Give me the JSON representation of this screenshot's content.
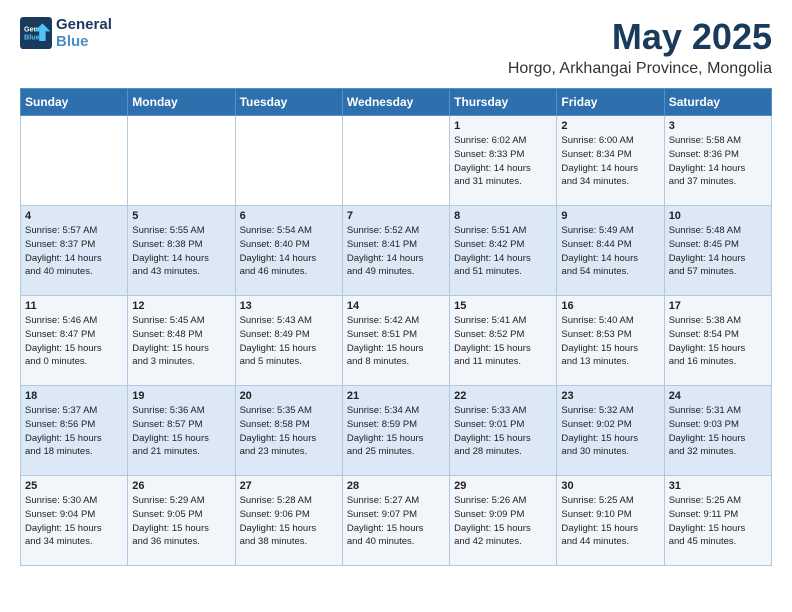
{
  "header": {
    "logo_line1": "General",
    "logo_line2": "Blue",
    "month_title": "May 2025",
    "location": "Horgo, Arkhangai Province, Mongolia"
  },
  "days_of_week": [
    "Sunday",
    "Monday",
    "Tuesday",
    "Wednesday",
    "Thursday",
    "Friday",
    "Saturday"
  ],
  "weeks": [
    [
      {
        "day": "",
        "info": ""
      },
      {
        "day": "",
        "info": ""
      },
      {
        "day": "",
        "info": ""
      },
      {
        "day": "",
        "info": ""
      },
      {
        "day": "1",
        "info": "Sunrise: 6:02 AM\nSunset: 8:33 PM\nDaylight: 14 hours\nand 31 minutes."
      },
      {
        "day": "2",
        "info": "Sunrise: 6:00 AM\nSunset: 8:34 PM\nDaylight: 14 hours\nand 34 minutes."
      },
      {
        "day": "3",
        "info": "Sunrise: 5:58 AM\nSunset: 8:36 PM\nDaylight: 14 hours\nand 37 minutes."
      }
    ],
    [
      {
        "day": "4",
        "info": "Sunrise: 5:57 AM\nSunset: 8:37 PM\nDaylight: 14 hours\nand 40 minutes."
      },
      {
        "day": "5",
        "info": "Sunrise: 5:55 AM\nSunset: 8:38 PM\nDaylight: 14 hours\nand 43 minutes."
      },
      {
        "day": "6",
        "info": "Sunrise: 5:54 AM\nSunset: 8:40 PM\nDaylight: 14 hours\nand 46 minutes."
      },
      {
        "day": "7",
        "info": "Sunrise: 5:52 AM\nSunset: 8:41 PM\nDaylight: 14 hours\nand 49 minutes."
      },
      {
        "day": "8",
        "info": "Sunrise: 5:51 AM\nSunset: 8:42 PM\nDaylight: 14 hours\nand 51 minutes."
      },
      {
        "day": "9",
        "info": "Sunrise: 5:49 AM\nSunset: 8:44 PM\nDaylight: 14 hours\nand 54 minutes."
      },
      {
        "day": "10",
        "info": "Sunrise: 5:48 AM\nSunset: 8:45 PM\nDaylight: 14 hours\nand 57 minutes."
      }
    ],
    [
      {
        "day": "11",
        "info": "Sunrise: 5:46 AM\nSunset: 8:47 PM\nDaylight: 15 hours\nand 0 minutes."
      },
      {
        "day": "12",
        "info": "Sunrise: 5:45 AM\nSunset: 8:48 PM\nDaylight: 15 hours\nand 3 minutes."
      },
      {
        "day": "13",
        "info": "Sunrise: 5:43 AM\nSunset: 8:49 PM\nDaylight: 15 hours\nand 5 minutes."
      },
      {
        "day": "14",
        "info": "Sunrise: 5:42 AM\nSunset: 8:51 PM\nDaylight: 15 hours\nand 8 minutes."
      },
      {
        "day": "15",
        "info": "Sunrise: 5:41 AM\nSunset: 8:52 PM\nDaylight: 15 hours\nand 11 minutes."
      },
      {
        "day": "16",
        "info": "Sunrise: 5:40 AM\nSunset: 8:53 PM\nDaylight: 15 hours\nand 13 minutes."
      },
      {
        "day": "17",
        "info": "Sunrise: 5:38 AM\nSunset: 8:54 PM\nDaylight: 15 hours\nand 16 minutes."
      }
    ],
    [
      {
        "day": "18",
        "info": "Sunrise: 5:37 AM\nSunset: 8:56 PM\nDaylight: 15 hours\nand 18 minutes."
      },
      {
        "day": "19",
        "info": "Sunrise: 5:36 AM\nSunset: 8:57 PM\nDaylight: 15 hours\nand 21 minutes."
      },
      {
        "day": "20",
        "info": "Sunrise: 5:35 AM\nSunset: 8:58 PM\nDaylight: 15 hours\nand 23 minutes."
      },
      {
        "day": "21",
        "info": "Sunrise: 5:34 AM\nSunset: 8:59 PM\nDaylight: 15 hours\nand 25 minutes."
      },
      {
        "day": "22",
        "info": "Sunrise: 5:33 AM\nSunset: 9:01 PM\nDaylight: 15 hours\nand 28 minutes."
      },
      {
        "day": "23",
        "info": "Sunrise: 5:32 AM\nSunset: 9:02 PM\nDaylight: 15 hours\nand 30 minutes."
      },
      {
        "day": "24",
        "info": "Sunrise: 5:31 AM\nSunset: 9:03 PM\nDaylight: 15 hours\nand 32 minutes."
      }
    ],
    [
      {
        "day": "25",
        "info": "Sunrise: 5:30 AM\nSunset: 9:04 PM\nDaylight: 15 hours\nand 34 minutes."
      },
      {
        "day": "26",
        "info": "Sunrise: 5:29 AM\nSunset: 9:05 PM\nDaylight: 15 hours\nand 36 minutes."
      },
      {
        "day": "27",
        "info": "Sunrise: 5:28 AM\nSunset: 9:06 PM\nDaylight: 15 hours\nand 38 minutes."
      },
      {
        "day": "28",
        "info": "Sunrise: 5:27 AM\nSunset: 9:07 PM\nDaylight: 15 hours\nand 40 minutes."
      },
      {
        "day": "29",
        "info": "Sunrise: 5:26 AM\nSunset: 9:09 PM\nDaylight: 15 hours\nand 42 minutes."
      },
      {
        "day": "30",
        "info": "Sunrise: 5:25 AM\nSunset: 9:10 PM\nDaylight: 15 hours\nand 44 minutes."
      },
      {
        "day": "31",
        "info": "Sunrise: 5:25 AM\nSunset: 9:11 PM\nDaylight: 15 hours\nand 45 minutes."
      }
    ]
  ]
}
